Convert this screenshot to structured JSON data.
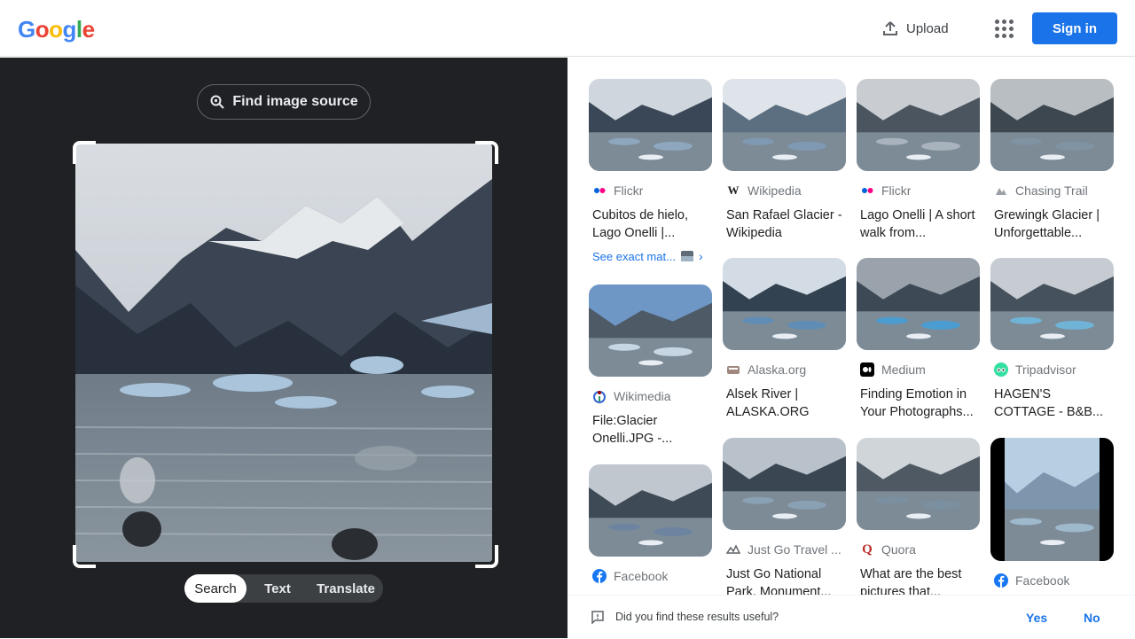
{
  "header": {
    "logo_letters": [
      {
        "ch": "G",
        "color": "#4285F4"
      },
      {
        "ch": "o",
        "color": "#EA4335"
      },
      {
        "ch": "o",
        "color": "#FBBC05"
      },
      {
        "ch": "g",
        "color": "#4285F4"
      },
      {
        "ch": "l",
        "color": "#34A853"
      },
      {
        "ch": "e",
        "color": "#EA4335"
      }
    ],
    "upload_label": "Upload",
    "signin_label": "Sign in"
  },
  "left_panel": {
    "find_source_label": "Find image source",
    "tabs": [
      {
        "label": "Search",
        "active": true
      },
      {
        "label": "Text",
        "active": false
      },
      {
        "label": "Translate",
        "active": false
      }
    ]
  },
  "results": [
    {
      "source": "Flickr",
      "icon": "flickr-icon",
      "title": "Cubitos de hielo, Lago Onelli |...",
      "see_exact": "See exact mat..."
    },
    {
      "source": "Wikipedia",
      "icon": "wikipedia-icon",
      "title": "San Rafael Glacier - Wikipedia"
    },
    {
      "source": "Flickr",
      "icon": "flickr-icon",
      "title": "Lago Onelli | A short walk from..."
    },
    {
      "source": "Chasing Trail",
      "icon": "chasing-trail-icon",
      "title": "Grewingk Glacier | Unforgettable..."
    },
    {
      "source": "Wikimedia",
      "icon": "wikimedia-icon",
      "title": "File:Glacier Onelli.JPG -..."
    },
    {
      "source": "Alaska.org",
      "icon": "alaska-org-icon",
      "title": "Alsek River | ALASKA.ORG"
    },
    {
      "source": "Medium",
      "icon": "medium-icon",
      "title": "Finding Emotion in Your Photographs..."
    },
    {
      "source": "Tripadvisor",
      "icon": "tripadvisor-icon",
      "title": "HAGEN'S COTTAGE - B&B..."
    },
    {
      "source": "Facebook",
      "icon": "facebook-icon",
      "title": ""
    },
    {
      "source": "Just Go Travel ...",
      "icon": "just-go-travel-icon",
      "title": "Just Go National Park, Monument..."
    },
    {
      "source": "Quora",
      "icon": "quora-icon",
      "title": "What are the best pictures that..."
    },
    {
      "source": "Facebook",
      "icon": "facebook-icon",
      "title": ""
    }
  ],
  "feedback": {
    "question": "Did you find these results useful?",
    "yes": "Yes",
    "no": "No"
  }
}
